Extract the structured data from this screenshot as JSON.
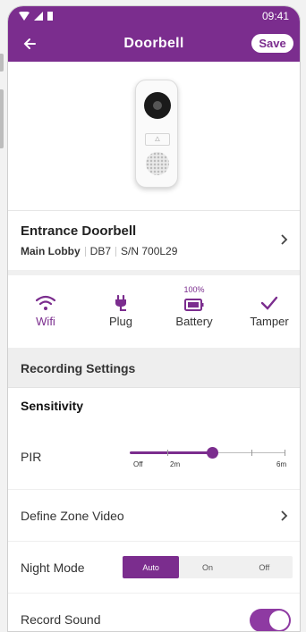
{
  "status": {
    "time": "09:41"
  },
  "header": {
    "title": "Doorbell",
    "save_label": "Save"
  },
  "device": {
    "button_glyph": "△",
    "name": "Entrance Doorbell",
    "location": "Main Lobby",
    "model": "DB7",
    "serial": "S/N 700L29"
  },
  "status_items": [
    {
      "label": "Wifi",
      "icon": "wifi-icon",
      "active": true
    },
    {
      "label": "Plug",
      "icon": "plug-icon"
    },
    {
      "label": "Battery",
      "icon": "battery-icon",
      "percent": "100%"
    },
    {
      "label": "Tamper",
      "icon": "check-icon"
    }
  ],
  "recording": {
    "section_title": "Recording Settings",
    "sensitivity_label": "Sensitivity",
    "pir": {
      "label": "PIR",
      "tick_labels": [
        "Off",
        "2m",
        "6m"
      ],
      "value_fraction": 0.53
    },
    "zone_label": "Define Zone Video",
    "night_mode": {
      "label": "Night Mode",
      "options": [
        "Auto",
        "On",
        "Off"
      ],
      "selected": "Auto"
    },
    "record_sound": {
      "label": "Record Sound",
      "on": true
    }
  },
  "colors": {
    "accent": "#7b2d8e",
    "background": "#f4f4f4"
  }
}
